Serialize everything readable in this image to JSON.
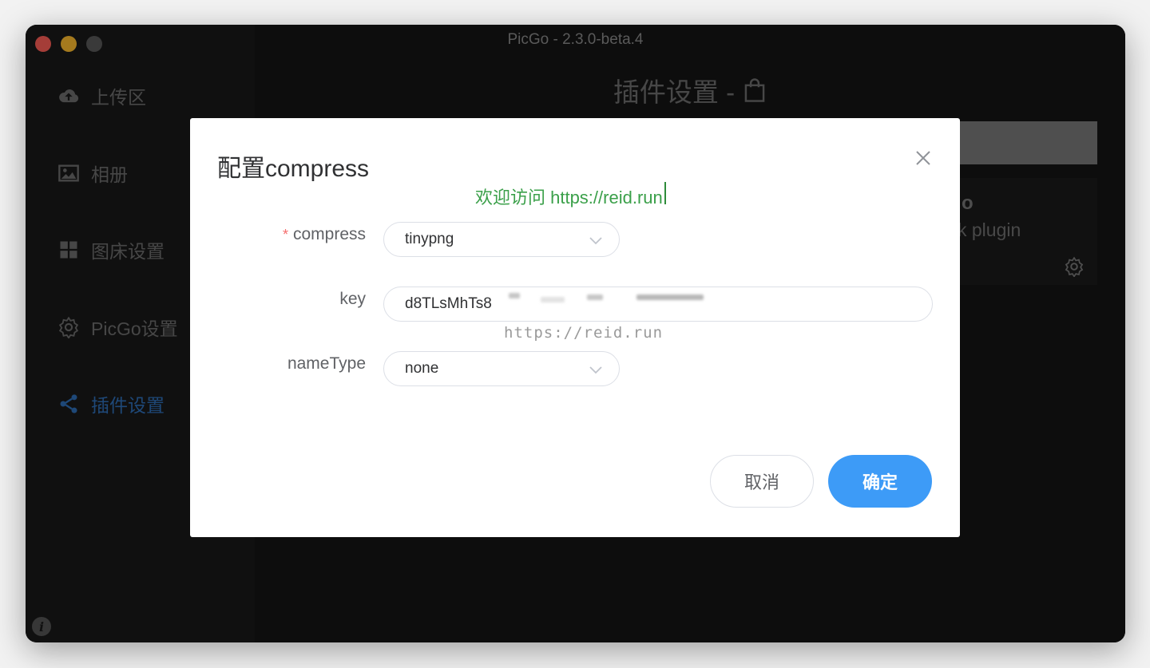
{
  "window": {
    "title": "PicGo - 2.3.0-beta.4"
  },
  "sidebar": {
    "items": [
      {
        "label": "上传区",
        "icon": "cloud-upload-icon"
      },
      {
        "label": "相册",
        "icon": "image-icon"
      },
      {
        "label": "图床设置",
        "icon": "grid-icon"
      },
      {
        "label": "PicGo设置",
        "icon": "gear-icon"
      },
      {
        "label": "插件设置",
        "icon": "share-icon",
        "active": true
      }
    ]
  },
  "main": {
    "page_title": "插件设置 -",
    "plugin_card": {
      "name_partial": "o",
      "desc_partial": "k plugin"
    }
  },
  "dialog": {
    "title": "配置compress",
    "watermark_top": "欢迎访问 https://reid.run",
    "watermark_mid": "https://reid.run",
    "fields": {
      "compress": {
        "label": "compress",
        "required": true,
        "value": "tinypng"
      },
      "key": {
        "label": "key",
        "value": "d8TLsMhTs8"
      },
      "nameType": {
        "label": "nameType",
        "value": "none"
      }
    },
    "cancel_label": "取消",
    "confirm_label": "确定"
  },
  "colors": {
    "accent": "#3d9bf7",
    "active_nav": "#2f6fb8",
    "required": "#f56c6c"
  }
}
